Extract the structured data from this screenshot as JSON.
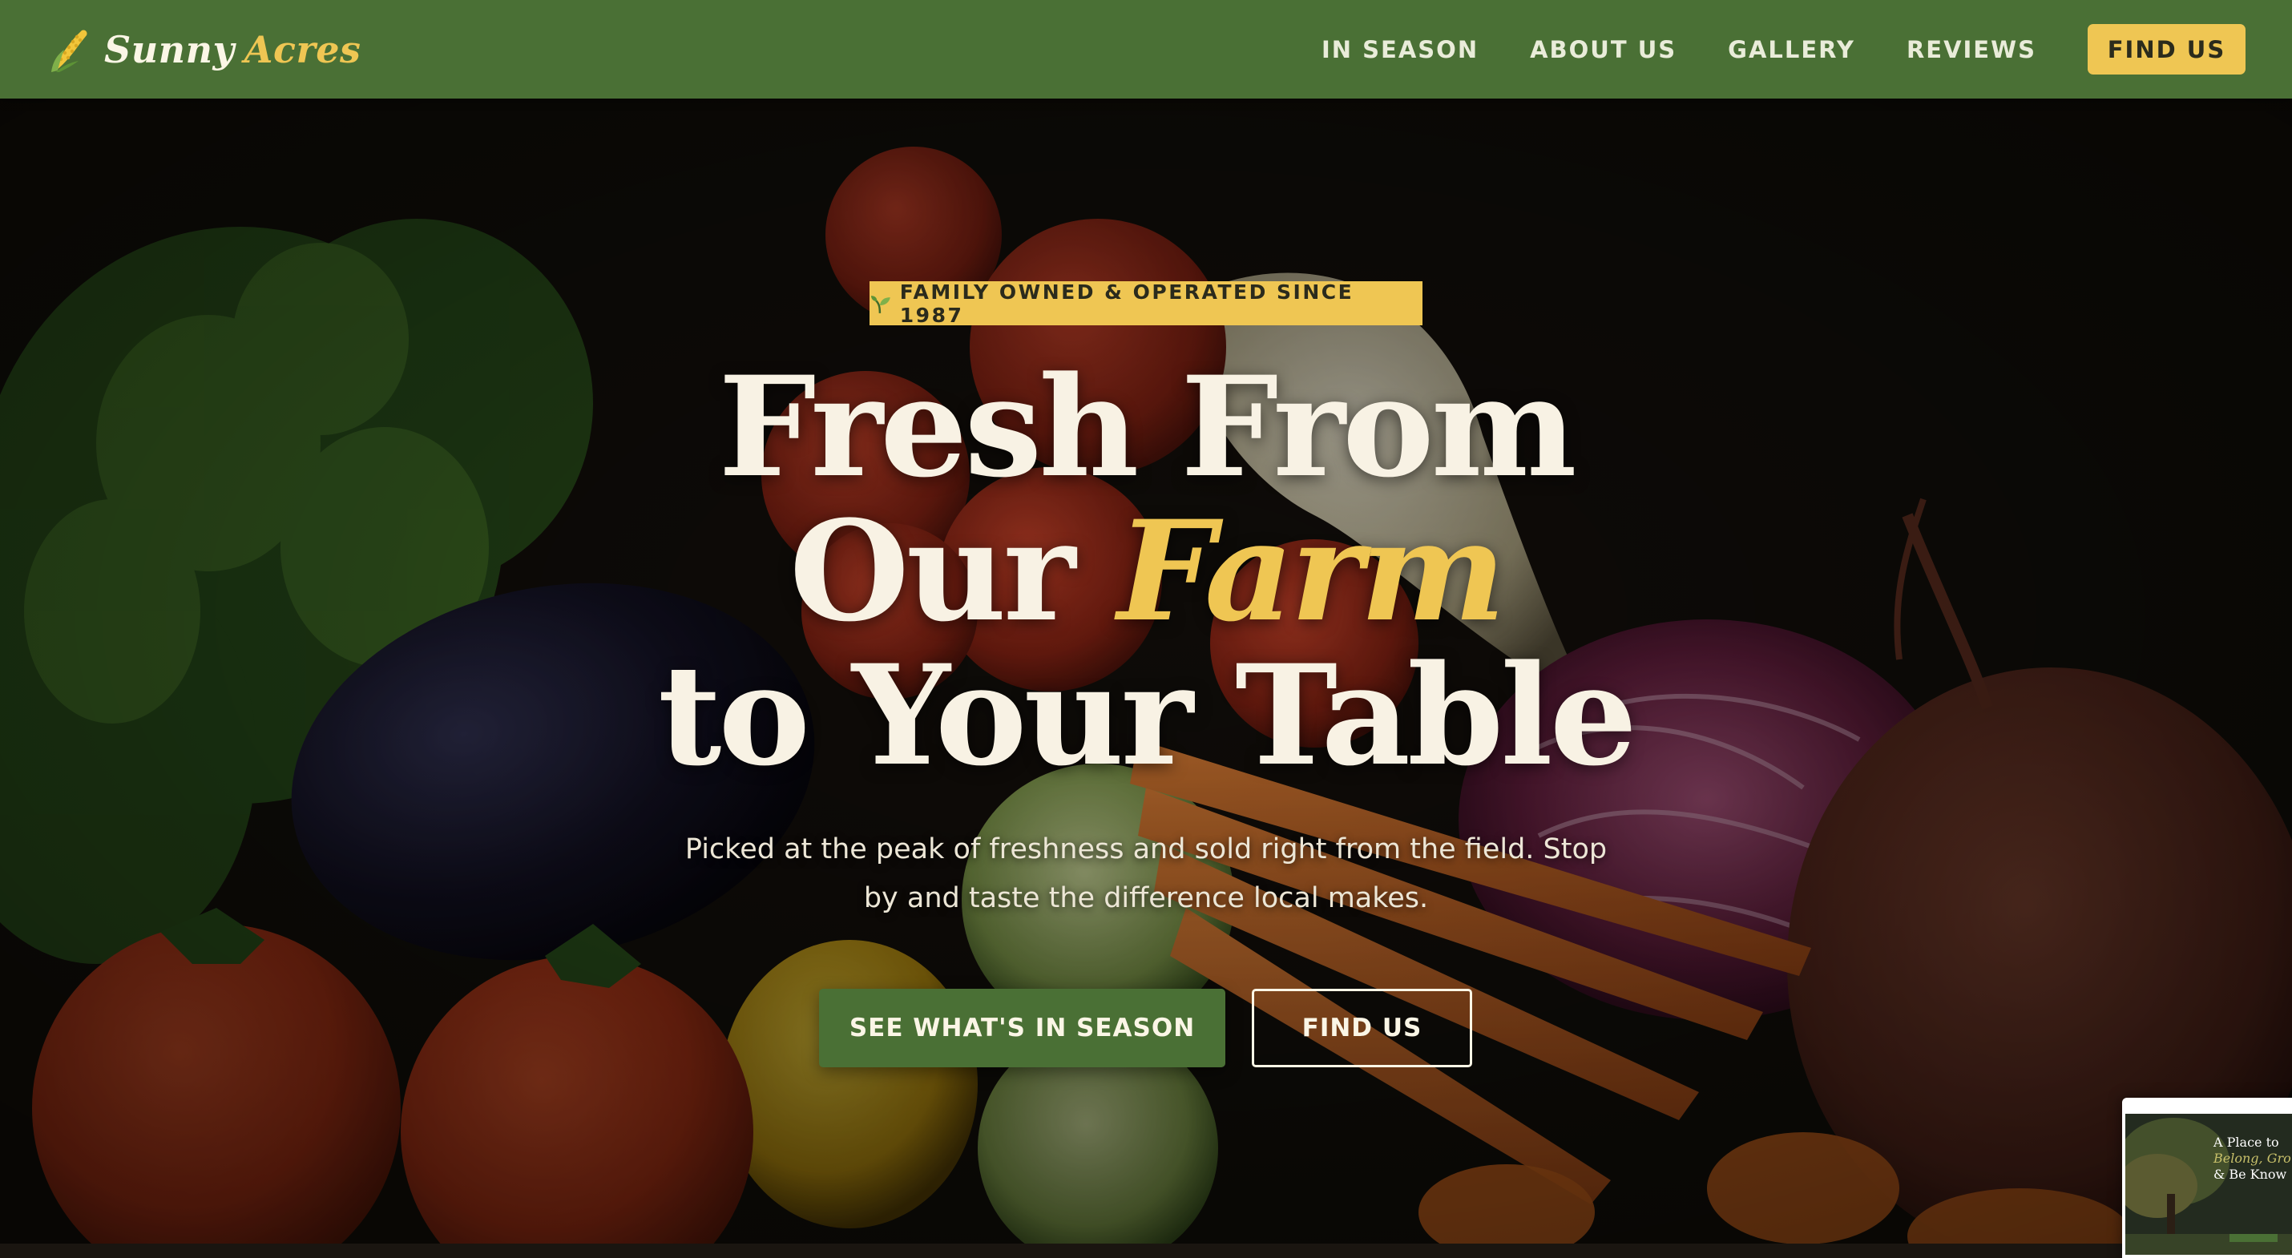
{
  "brand": {
    "name_part1": "Sunny",
    "name_part2": "Acres",
    "icon": "corn-icon"
  },
  "nav": {
    "links": [
      "IN SEASON",
      "ABOUT US",
      "GALLERY",
      "REVIEWS"
    ],
    "cta": "FIND US"
  },
  "hero": {
    "badge_icon": "sprout-icon",
    "badge": "FAMILY OWNED & OPERATED SINCE 1987",
    "headline_line1": "Fresh From",
    "headline_line2_a": "Our",
    "headline_line2_b": "Farm",
    "headline_line3": "to Your Table",
    "subtext": "Picked at the peak of freshness and sold right from the field. Stop by and taste the difference local makes.",
    "primary_button": "SEE WHAT'S IN SEASON",
    "secondary_button": "FIND US"
  },
  "thumbnail": {
    "line1": "A Place to",
    "line2": "Belong, Gro",
    "line3": "& Be Know"
  },
  "colors": {
    "nav_green": "#4a7035",
    "accent_yellow": "#efc653",
    "cream": "#f8f2e4",
    "hero_dark": "#1a1510"
  }
}
